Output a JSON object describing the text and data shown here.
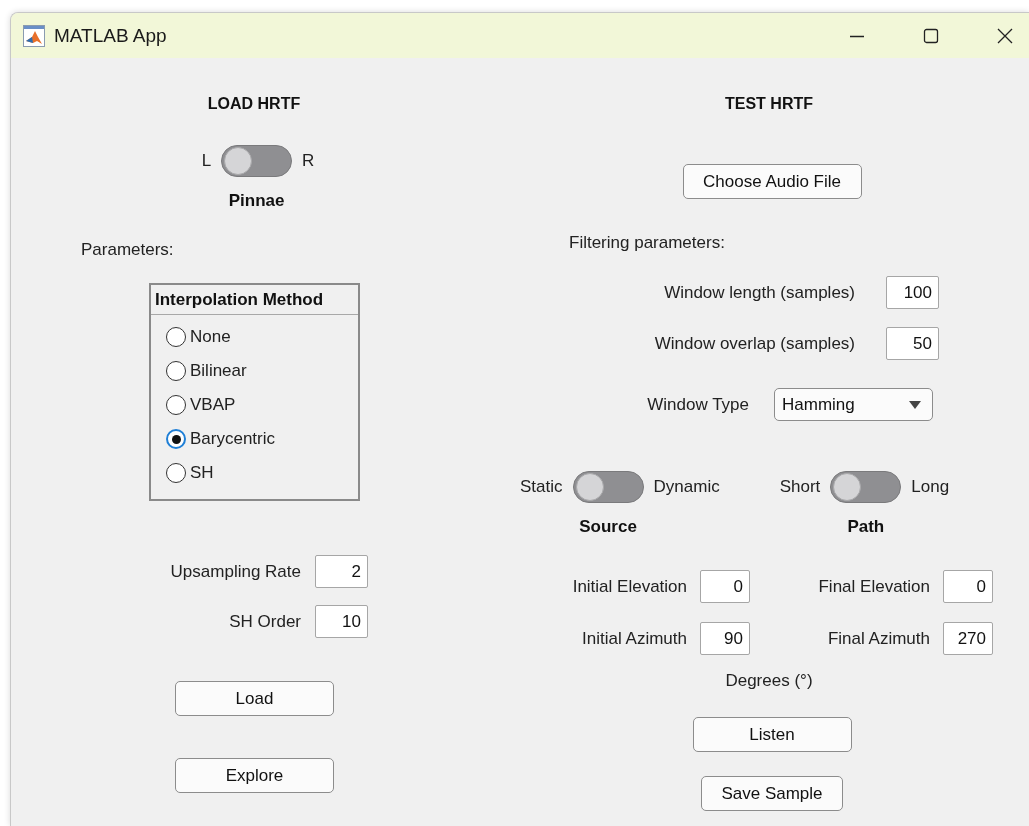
{
  "window": {
    "title": "MATLAB App"
  },
  "load_hrtf": {
    "heading": "LOAD HRTF",
    "pinnae_switch": {
      "left_label": "L",
      "right_label": "R",
      "on": false,
      "label": "Pinnae"
    },
    "parameters_label": "Parameters:",
    "interpolation_method": {
      "title": "Interpolation Method",
      "options": [
        {
          "label": "None",
          "selected": false
        },
        {
          "label": "Bilinear",
          "selected": false
        },
        {
          "label": "VBAP",
          "selected": false
        },
        {
          "label": "Barycentric",
          "selected": true
        },
        {
          "label": "SH",
          "selected": false
        }
      ]
    },
    "fields": [
      {
        "label": "Upsampling Rate",
        "value": "2"
      },
      {
        "label": "SH Order",
        "value": "10"
      }
    ],
    "buttons": [
      "Load",
      "Explore"
    ]
  },
  "test_hrtf": {
    "heading": "TEST HRTF",
    "choose_button": "Choose Audio File",
    "filtering_label": "Filtering parameters:",
    "fields": [
      {
        "label": "Window length (samples)",
        "value": "100"
      },
      {
        "label": "Window overlap (samples)",
        "value": "50"
      }
    ],
    "window_type": {
      "label": "Window Type",
      "value": "Hamming"
    },
    "switches": [
      {
        "left_label": "Static",
        "right_label": "Dynamic",
        "on": false,
        "label": "Source"
      },
      {
        "left_label": "Short",
        "right_label": "Long",
        "on": false,
        "label": "Path"
      }
    ],
    "positions": [
      {
        "label": "Initial Elevation",
        "value": "0"
      },
      {
        "label": "Final Elevation",
        "value": "0"
      },
      {
        "label": "Initial Azimuth",
        "value": "90"
      },
      {
        "label": "Final Azimuth",
        "value": "270"
      }
    ],
    "units": "Degrees (°)",
    "buttons": [
      "Listen",
      "Save Sample"
    ]
  }
}
